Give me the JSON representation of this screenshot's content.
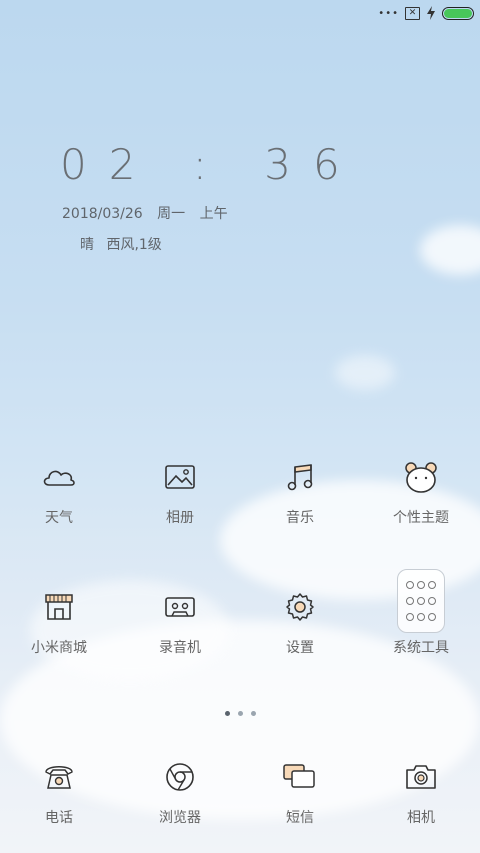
{
  "status_bar": {
    "signal_icon": "dots-icon",
    "sim_icon": "no-sim-icon",
    "charging_icon": "bolt-icon",
    "battery_level": 1.0,
    "battery_color": "#48c75a"
  },
  "lockscreen": {
    "time": "02 : 36",
    "date": "2018/03/26",
    "weekday": "周一",
    "ampm": "上午",
    "weather_condition": "晴",
    "wind": "西风,1级"
  },
  "apps": {
    "row1": [
      {
        "label": "天气",
        "icon": "cloud-icon"
      },
      {
        "label": "相册",
        "icon": "gallery-icon"
      },
      {
        "label": "音乐",
        "icon": "music-note-icon"
      },
      {
        "label": "个性主题",
        "icon": "bear-theme-icon"
      }
    ],
    "row2": [
      {
        "label": "小米商城",
        "icon": "store-icon"
      },
      {
        "label": "录音机",
        "icon": "cassette-icon"
      },
      {
        "label": "设置",
        "icon": "gear-icon"
      },
      {
        "label": "系统工具",
        "icon": "folder-icon"
      }
    ],
    "dock": [
      {
        "label": "电话",
        "icon": "phone-icon"
      },
      {
        "label": "浏览器",
        "icon": "browser-icon"
      },
      {
        "label": "短信",
        "icon": "message-icon"
      },
      {
        "label": "相机",
        "icon": "camera-icon"
      }
    ]
  },
  "page_indicator": {
    "pages": 3,
    "active": 1
  }
}
